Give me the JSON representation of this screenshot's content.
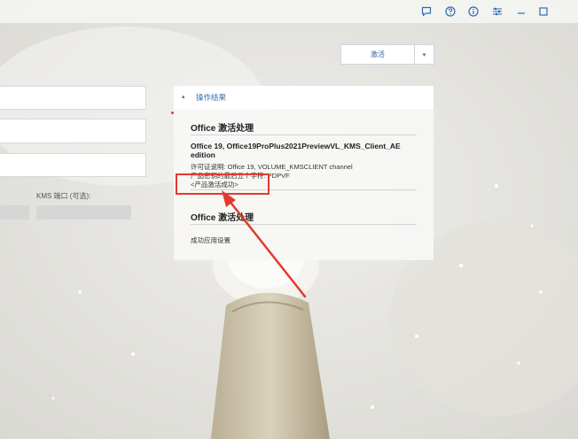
{
  "titlebar": {
    "icons": [
      "chat-icon",
      "help-icon",
      "info-icon",
      "settings-icon",
      "minimize-icon",
      "maximize-icon"
    ]
  },
  "activation": {
    "button_label": "激活",
    "dropdown_glyph": "▾"
  },
  "form": {
    "kms_port_label": "KMS 端口 (可选):"
  },
  "result_panel": {
    "chevron": "▴",
    "title": "操作结果",
    "section1": {
      "title": "Office 激活处理",
      "product_name": "Office 19, Office19ProPlus2021PreviewVL_KMS_Client_AE edition",
      "license_desc": "许可证说明: Office 19, VOLUME_KMSCLIENT channel",
      "key_tail": "产品密钥的最后五个字符: PDPVF",
      "status": "<产品激活成功>"
    },
    "section2": {
      "title": "Office 激活处理",
      "status": "成功应用设置"
    }
  },
  "colors": {
    "accent": "#3a6fb0",
    "highlight": "#e23b2e",
    "panel_bg": "#f7f7f5"
  }
}
